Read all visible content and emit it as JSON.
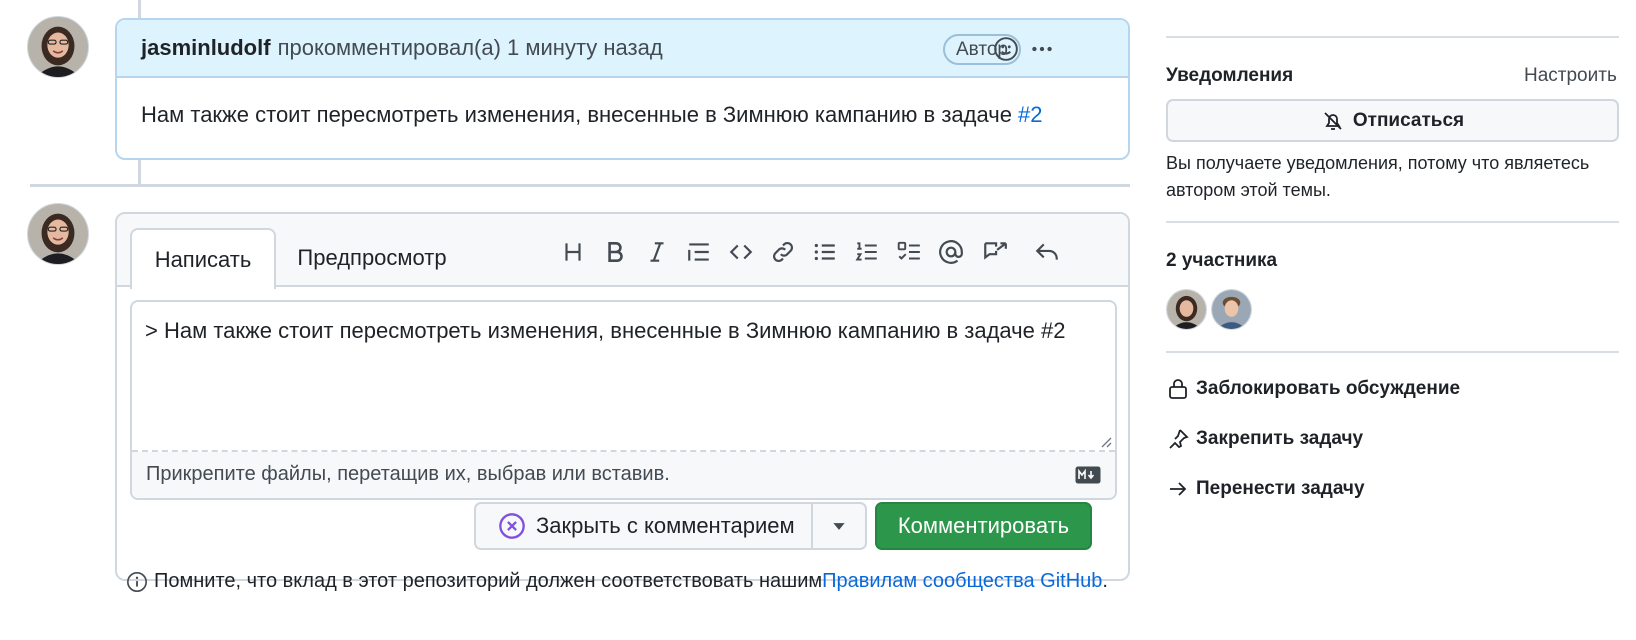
{
  "comment": {
    "author": "jasminludolf",
    "meta": "прокомментировал(а) 1 минуту назад",
    "badge": "Автор",
    "body_text": "Нам также стоит пересмотреть изменения, внесенные в Зимнюю кампанию в задаче ",
    "issue_link": "#2",
    "icons": [
      "smiley-icon",
      "kebab-horizontal-icon"
    ]
  },
  "editor": {
    "tabs": [
      {
        "label": "Написать",
        "active": true
      },
      {
        "label": "Предпросмотр",
        "active": false
      }
    ],
    "toolbar_icons": [
      "heading-icon",
      "bold-icon",
      "italic-icon",
      "quote-icon",
      "code-icon",
      "link-icon",
      "unordered-list-icon",
      "ordered-list-icon",
      "task-list-icon",
      "mention-icon",
      "cross-reference-icon",
      "reply-icon"
    ],
    "textarea_value": "> Нам также стоит пересмотреть изменения, внесенные в Зимнюю кампанию в задаче #2",
    "attach_text": "Прикрепите файлы, перетащив их, выбрав или вставив.",
    "close_button": "Закрыть с комментарием",
    "comment_button": "Комментировать"
  },
  "note": {
    "text": "Помните, что вклад в этот репозиторий должен соответствовать нашим ",
    "link": "Правилам сообщества GitHub",
    "suffix": "."
  },
  "sidebar": {
    "notifications_heading": "Уведомления",
    "customize_link": "Настроить",
    "unsubscribe_button": "Отписаться",
    "notifications_reason": "Вы получаете уведомления, потому что являетесь автором этой темы.",
    "participants_heading": "2 участника",
    "actions": [
      "Заблокировать обсуждение",
      "Закрепить задачу",
      "Перенести задачу"
    ]
  },
  "colors": {
    "accent_link": "#0969da",
    "primary_button": "#2c974b",
    "comment_header": "#ddf4ff",
    "close_icon": "#8250df"
  }
}
